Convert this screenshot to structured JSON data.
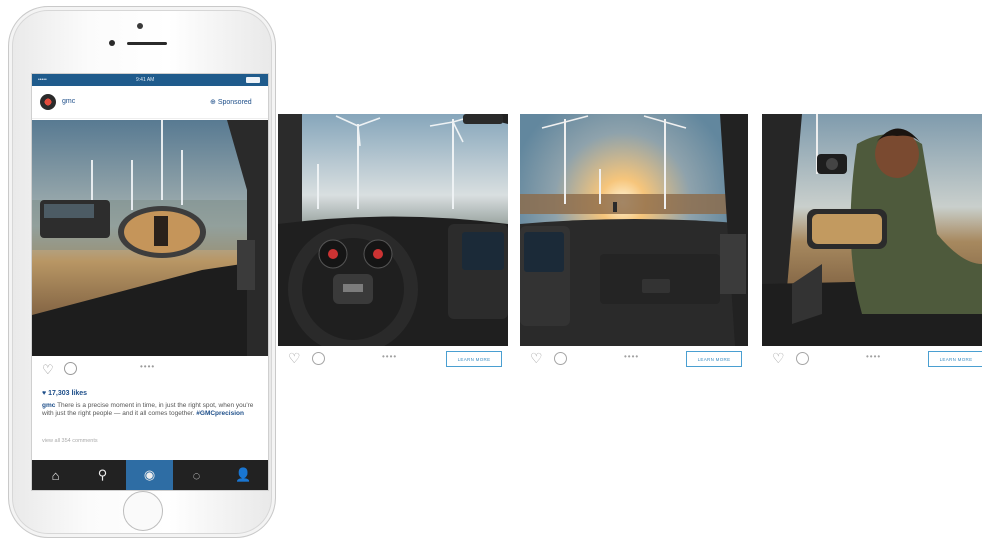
{
  "phone": {
    "status": {
      "carrier": "•••••",
      "time": "9:41 AM"
    },
    "post": {
      "username": "gmc",
      "sponsored_label": "Sponsored",
      "likes": "♥ 17,303 likes",
      "caption_user": "gmc",
      "caption_text": " There is a precise moment in time, in just the right spot, when you're with just the right people — and it all comes together. ",
      "caption_tag": "#GMCprecision",
      "view_comments": "view all 354 comments",
      "dots": "••••"
    },
    "tabbar": {
      "items": [
        {
          "icon": "home-icon",
          "glyph": "⌂"
        },
        {
          "icon": "search-icon",
          "glyph": "⚲"
        },
        {
          "icon": "camera-icon",
          "glyph": "◉"
        },
        {
          "icon": "activity-icon",
          "glyph": "◌"
        },
        {
          "icon": "profile-icon",
          "glyph": "👤"
        }
      ]
    }
  },
  "carousel": {
    "panels": [
      {
        "dots": "••••",
        "cta": "LEARN MORE"
      },
      {
        "dots": "••••",
        "cta": "LEARN MORE"
      },
      {
        "dots": "••••",
        "cta": "LEARN MORE"
      }
    ]
  },
  "colors": {
    "brand_blue": "#1d4e89",
    "cta_blue": "#3b8dc3",
    "tabbar_bg": "#222222",
    "tab_active": "#2e6da4"
  }
}
